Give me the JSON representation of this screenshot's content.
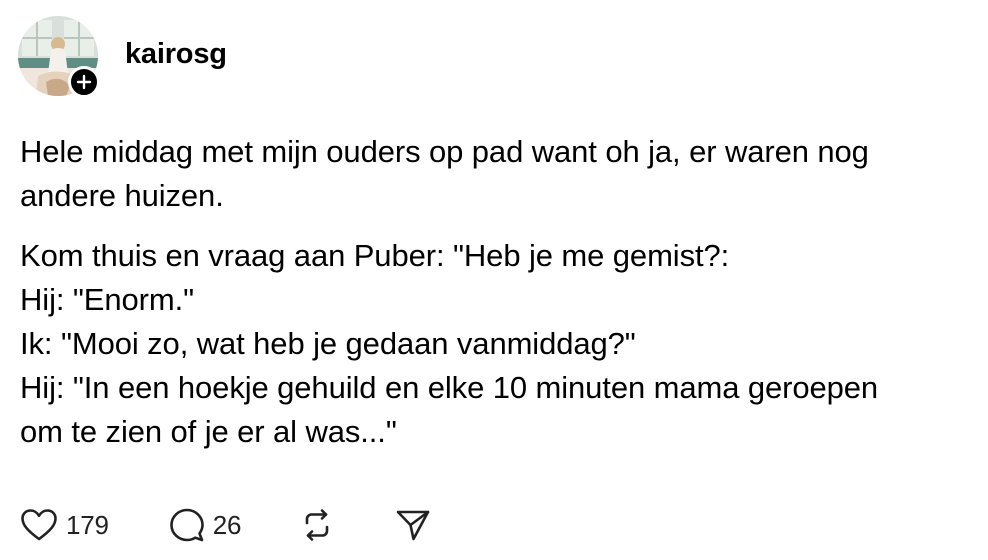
{
  "post": {
    "author": {
      "username": "kairosg",
      "avatar_icon": "profile-photo",
      "follow_icon": "plus-icon"
    },
    "paragraphs": [
      {
        "lines": [
          "Hele middag met mijn ouders op pad want oh ja, er waren nog",
          "andere huizen."
        ]
      },
      {
        "lines": [
          "Kom thuis en vraag aan Puber: \"Heb je me gemist?:",
          "Hij: \"Enorm.\"",
          "Ik: \"Mooi zo, wat heb je gedaan vanmiddag?\"",
          "Hij: \"In een hoekje gehuild en elke 10 minuten mama geroepen",
          "om te zien of je er al was...\""
        ]
      }
    ],
    "actions": {
      "like": {
        "icon": "heart-icon",
        "count": "179"
      },
      "reply": {
        "icon": "comment-icon",
        "count": "26"
      },
      "repost": {
        "icon": "repost-icon"
      },
      "share": {
        "icon": "send-icon"
      }
    }
  },
  "colors": {
    "text": "#000000",
    "badge": "#000000",
    "icon": "#222222"
  }
}
